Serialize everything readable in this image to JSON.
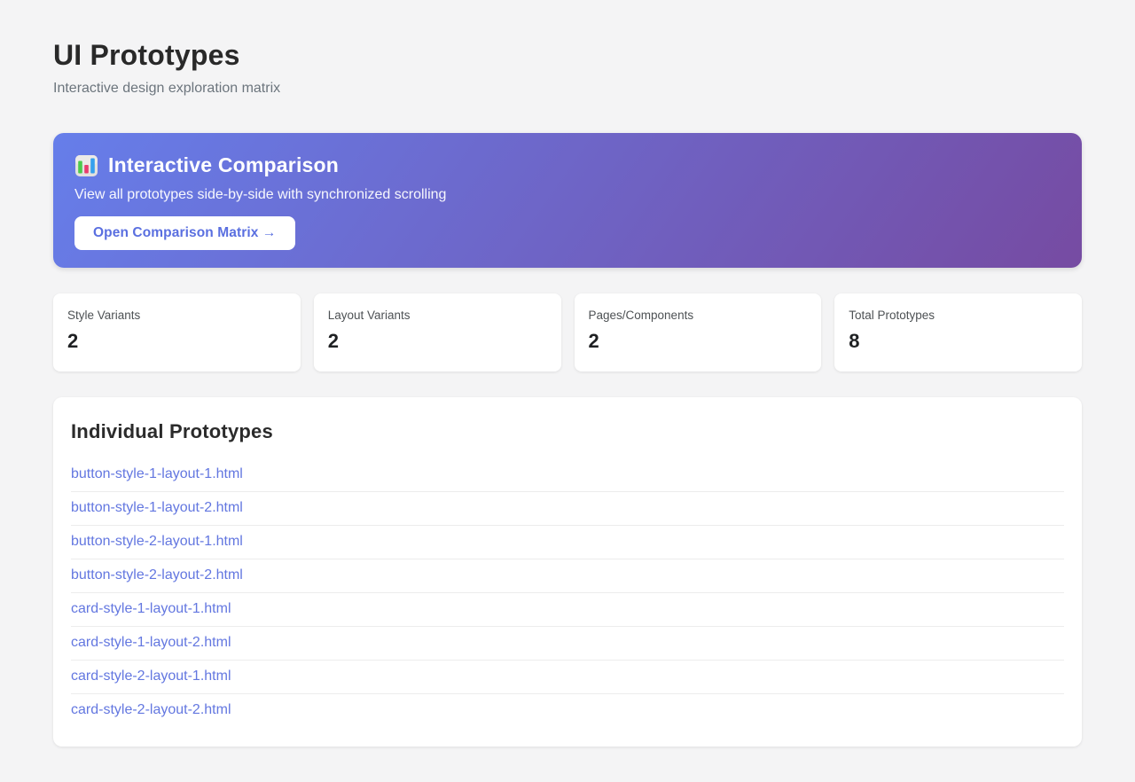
{
  "page": {
    "title": "UI Prototypes",
    "subtitle": "Interactive design exploration matrix"
  },
  "banner": {
    "icon": "bar-chart-emoji",
    "title": "Interactive Comparison",
    "description": "View all prototypes side-by-side with synchronized scrolling",
    "button_label": "Open Comparison Matrix →",
    "gradient_start": "#667eea",
    "gradient_end": "#764ba2",
    "button_text_color": "#5a6fe0"
  },
  "stats": [
    {
      "label": "Style Variants",
      "value": "2"
    },
    {
      "label": "Layout Variants",
      "value": "2"
    },
    {
      "label": "Pages/Components",
      "value": "2"
    },
    {
      "label": "Total Prototypes",
      "value": "8"
    }
  ],
  "prototypes": {
    "heading": "Individual Prototypes",
    "links": [
      "button-style-1-layout-1.html",
      "button-style-1-layout-2.html",
      "button-style-2-layout-1.html",
      "button-style-2-layout-2.html",
      "card-style-1-layout-1.html",
      "card-style-1-layout-2.html",
      "card-style-2-layout-1.html",
      "card-style-2-layout-2.html"
    ]
  },
  "colors": {
    "page_background": "#f4f4f5",
    "link": "#6377e0",
    "icon_bar_green": "#4cc94c",
    "icon_bar_pink": "#ea3b6e",
    "icon_bar_blue": "#35a0ee"
  }
}
